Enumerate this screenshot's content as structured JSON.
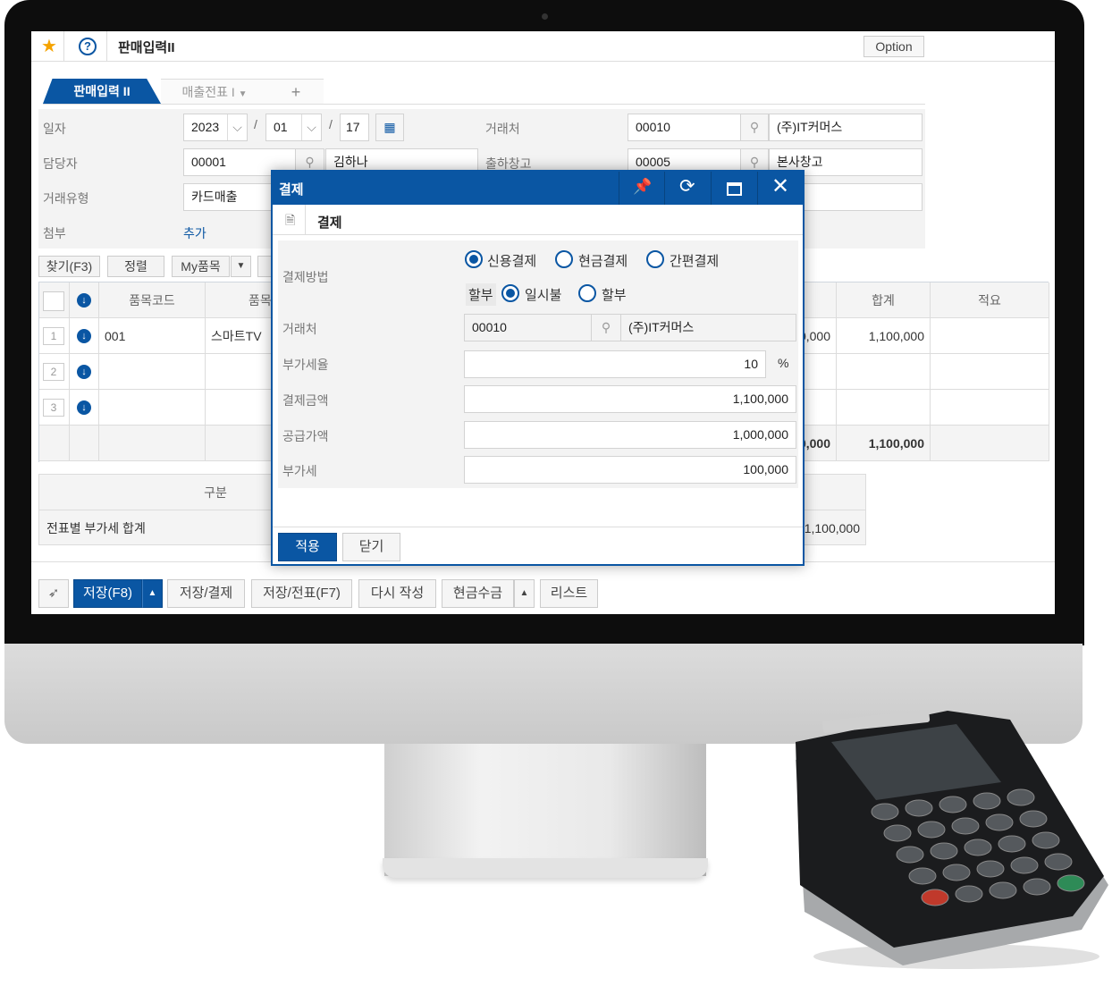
{
  "header": {
    "title": "판매입력II",
    "option_label": "Option",
    "star_icon": "star-icon",
    "help_icon": "help-icon"
  },
  "tabs": [
    {
      "label": "판매입력 II",
      "active": true
    },
    {
      "label": "매출전표 I"
    },
    {
      "label": "+"
    }
  ],
  "form": {
    "date": {
      "label": "일자",
      "year": "2023",
      "month": "01",
      "day": "17",
      "sep": "/"
    },
    "manager": {
      "label": "담당자",
      "code": "00001",
      "name": "김하나"
    },
    "trade_type": {
      "label": "거래유형",
      "value": "카드매출"
    },
    "attach": {
      "label": "첨부",
      "link": "추가"
    },
    "customer": {
      "label": "거래처",
      "code": "00010",
      "name": "(주)IT커머스"
    },
    "warehouse": {
      "label": "출하창고",
      "code": "00005",
      "name": "본사창고"
    }
  },
  "toolbar": {
    "find": "찾기(F3)",
    "sort": "정렬",
    "my_items": "My품목"
  },
  "grid": {
    "headers": {
      "code": "품목코드",
      "name": "품목",
      "total": "합계",
      "memo": "적요"
    },
    "rows": [
      {
        "no": "1",
        "code": "001",
        "name": "스마트TV",
        "amount": "100,000",
        "total": "1,100,000"
      },
      {
        "no": "2"
      },
      {
        "no": "3"
      }
    ],
    "footer": {
      "amount": "100,000",
      "total": "1,100,000"
    }
  },
  "summary": {
    "header": "구분",
    "row_label": "전표별 부가세 합계",
    "row_value": "1,100,000"
  },
  "bottom": {
    "save": "저장(F8)",
    "save_pay": "저장/결제",
    "save_slip": "저장/전표(F7)",
    "rewrite": "다시 작성",
    "cash": "현금수금",
    "list": "리스트"
  },
  "modal": {
    "title": "결제",
    "sub_title": "결제",
    "method_label": "결제방법",
    "methods": [
      {
        "label": "신용결제",
        "checked": true
      },
      {
        "label": "현금결제",
        "checked": false
      },
      {
        "label": "간편결제",
        "checked": false
      }
    ],
    "installment_label": "할부",
    "installments": [
      {
        "label": "일시불",
        "checked": true
      },
      {
        "label": "할부",
        "checked": false
      }
    ],
    "customer_label": "거래처",
    "customer_code": "00010",
    "customer_name": "(주)IT커머스",
    "vat_rate_label": "부가세율",
    "vat_rate": "10",
    "percent": "%",
    "pay_amount_label": "결제금액",
    "pay_amount": "1,100,000",
    "supply_label": "공급가액",
    "supply": "1,000,000",
    "vat_label": "부가세",
    "vat": "100,000",
    "apply": "적용",
    "close": "닫기"
  },
  "colors": {
    "primary": "#0a56a3",
    "panel": "#f3f3f3"
  }
}
